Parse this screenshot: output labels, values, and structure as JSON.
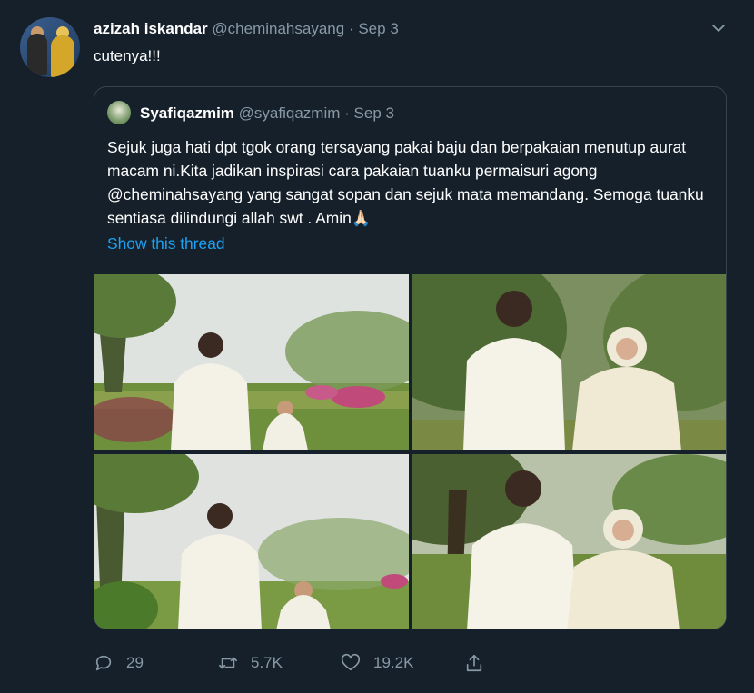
{
  "tweet": {
    "author_name": "azizah iskandar",
    "author_handle": "@cheminahsayang",
    "separator": "·",
    "date": "Sep 3",
    "text": "cutenya!!!"
  },
  "quoted": {
    "author_name": "Syafiqazmim",
    "author_handle": "@syafiqazmim",
    "separator": "·",
    "date": "Sep 3",
    "text": "Sejuk juga hati dpt tgok orang tersayang pakai baju dan berpakaian menutup aurat macam ni.Kita jadikan inspirasi cara pakaian tuanku permaisuri agong @cheminahsayang   yang sangat sopan dan sejuk mata memandang. Semoga tuanku sentiasa dilindungi allah swt . Amin🙏🏻",
    "show_thread": "Show this thread"
  },
  "actions": {
    "reply_count": "29",
    "retweet_count": "5.7K",
    "like_count": "19.2K"
  },
  "icons": {
    "reply": "reply-icon",
    "retweet": "retweet-icon",
    "like": "heart-icon",
    "share": "share-icon",
    "caret": "chevron-down-icon"
  },
  "colors": {
    "background": "#15202b",
    "secondary_text": "#8899a6",
    "link": "#1da1f2",
    "border": "#38444d"
  }
}
